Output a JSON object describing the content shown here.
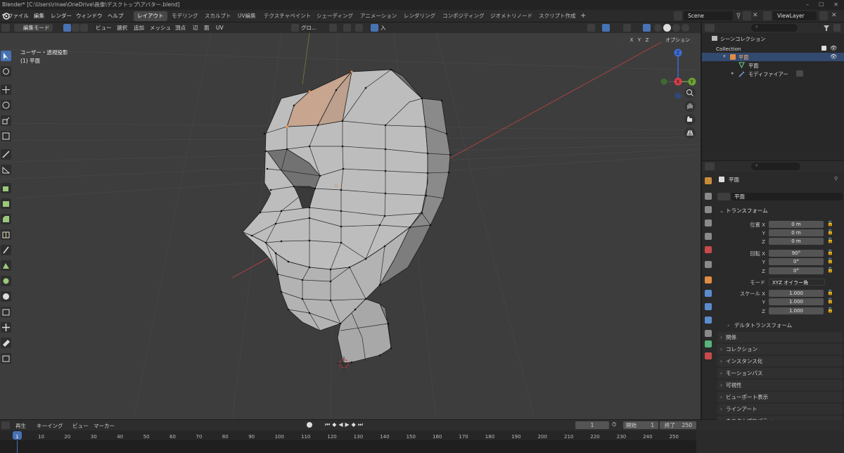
{
  "window": {
    "title": "Blender* [C:\\Users\\rinae\\OneDrive\\画像\\デスクトップ\\アバター.blend]",
    "controls": [
      "–",
      "☐",
      "✕"
    ]
  },
  "menubar": {
    "menus": [
      "ファイル",
      "編集",
      "レンダー",
      "ウィンドウ",
      "ヘルプ"
    ],
    "workspaces": [
      "レイアウト",
      "モデリング",
      "スカルプト",
      "UV編集",
      "テクスチャペイント",
      "シェーディング",
      "アニメーション",
      "レンダリング",
      "コンポジティング",
      "ジオメトリノード",
      "スクリプト作成"
    ],
    "active_workspace": "レイアウト",
    "add_tab": "+",
    "scene": "Scene",
    "view_layer": "ViewLayer"
  },
  "viewport_header": {
    "mode": "編集モード",
    "menus": [
      "ビュー",
      "選択",
      "追加",
      "メッシュ",
      "頂点",
      "辺",
      "面",
      "UV"
    ],
    "orientation": "グロ...",
    "snap": "入",
    "axes": [
      "X",
      "Y",
      "Z"
    ],
    "options": "オプション"
  },
  "viewport": {
    "view_name": "ユーザー・透視投影",
    "object_name": "(1) 平面",
    "gizmo": {
      "z": "Z",
      "y": "Y",
      "x": "X"
    },
    "colors": {
      "bg": "#3d3d3d",
      "mesh": "#b9b9b9",
      "select": "#ff8c42",
      "x_axis": "#c94b4b"
    }
  },
  "outliner": {
    "title": "シーンコレクション",
    "collection": "Collection",
    "object": "平面",
    "mesh": "平面",
    "modifier": "モディファイアー"
  },
  "properties": {
    "object_name": "平面",
    "data_name": "平面",
    "transform_header": "トランスフォーム",
    "location": {
      "label": "位置 X",
      "x": "0 m",
      "y": "0 m",
      "z": "0 m"
    },
    "rotation": {
      "label": "回転 X",
      "x": "90°",
      "y": "0°",
      "z": "0°"
    },
    "mode_label": "モード",
    "mode_value": "XYZ オイラー角",
    "scale": {
      "label": "スケール X",
      "x": "1.000",
      "y": "1.000",
      "z": "1.000"
    },
    "axis_y": "Y",
    "axis_z": "Z",
    "sections": [
      "デルタトランスフォーム",
      "関係",
      "コレクション",
      "インスタンス化",
      "モーションパス",
      "可視性",
      "ビューポート表示",
      "ラインアート",
      "カスタムプロパティ"
    ]
  },
  "timeline": {
    "menus": [
      "再生",
      "キーイング",
      "ビュー",
      "マーカー"
    ],
    "current_frame": "1",
    "start_label": "開始",
    "start": "1",
    "end_label": "終了",
    "end": "250",
    "ticks": [
      "1",
      "10",
      "20",
      "30",
      "40",
      "50",
      "60",
      "70",
      "80",
      "90",
      "100",
      "110",
      "120",
      "130",
      "140",
      "150",
      "160",
      "170",
      "180",
      "190",
      "200",
      "210",
      "220",
      "230",
      "240",
      "250"
    ]
  }
}
